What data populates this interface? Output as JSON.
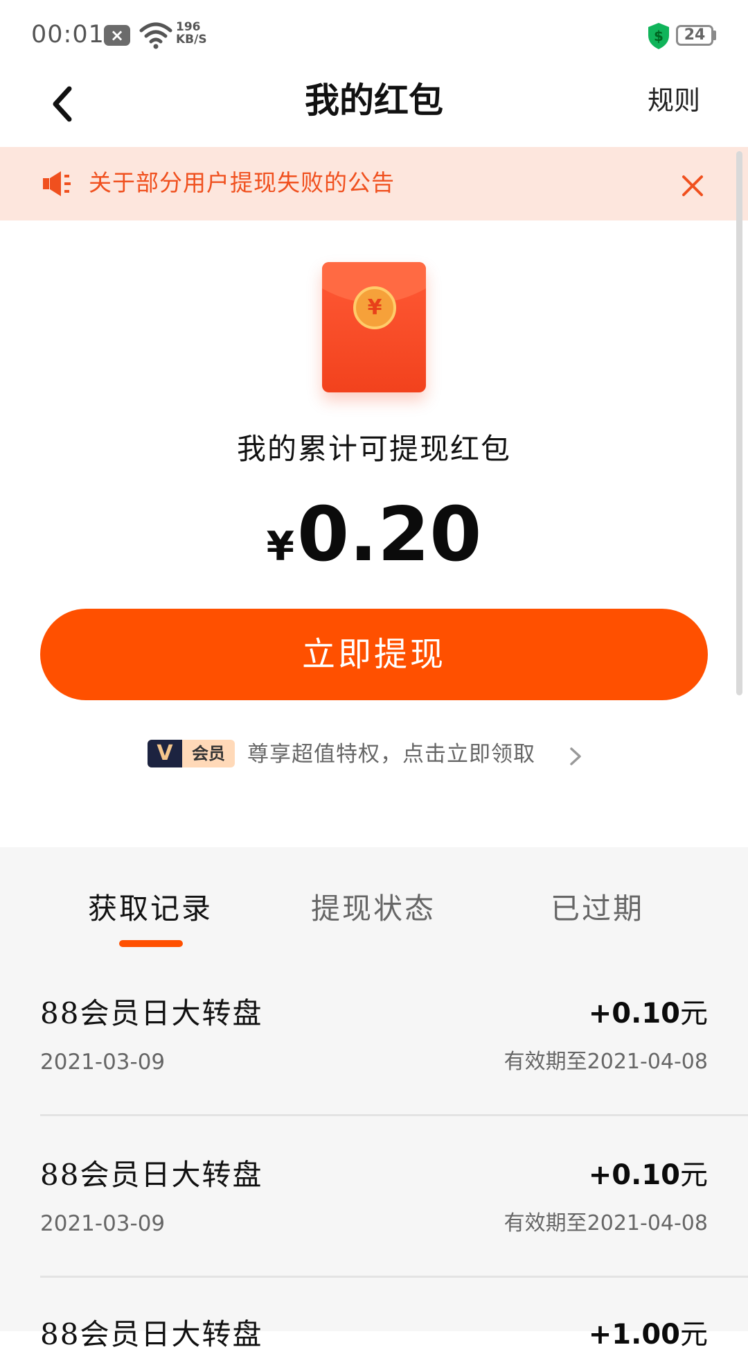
{
  "status_bar": {
    "time": "00:01",
    "notification_icon": "close-box-icon",
    "net_speed_value": "196",
    "net_speed_unit": "KB/S",
    "battery": "24"
  },
  "header": {
    "title": "我的红包",
    "rules_label": "规则"
  },
  "notice": {
    "text": "关于部分用户提现失败的公告"
  },
  "balance": {
    "label": "我的累计可提现红包",
    "currency": "¥",
    "amount": "0.20",
    "coin_symbol": "¥"
  },
  "withdraw_button": "立即提现",
  "vip": {
    "logo": "V",
    "badge": "会员",
    "text": "尊享超值特权，点击立即领取"
  },
  "tabs": [
    {
      "label": "获取记录",
      "active": true
    },
    {
      "label": "提现状态",
      "active": false
    },
    {
      "label": "已过期",
      "active": false
    }
  ],
  "records": [
    {
      "title": "88会员日大转盘",
      "date": "2021-03-09",
      "amount": "+0.10",
      "unit": "元",
      "expiry": "有效期至2021-04-08"
    },
    {
      "title": "88会员日大转盘",
      "date": "2021-03-09",
      "amount": "+0.10",
      "unit": "元",
      "expiry": "有效期至2021-04-08"
    },
    {
      "title": "88会员日大转盘",
      "amount": "+1.00",
      "unit": "元"
    }
  ],
  "colors": {
    "accent": "#ff5000",
    "notice_bg": "#fde6dd",
    "notice_text": "#f0501e",
    "records_bg": "#f6f6f6"
  }
}
